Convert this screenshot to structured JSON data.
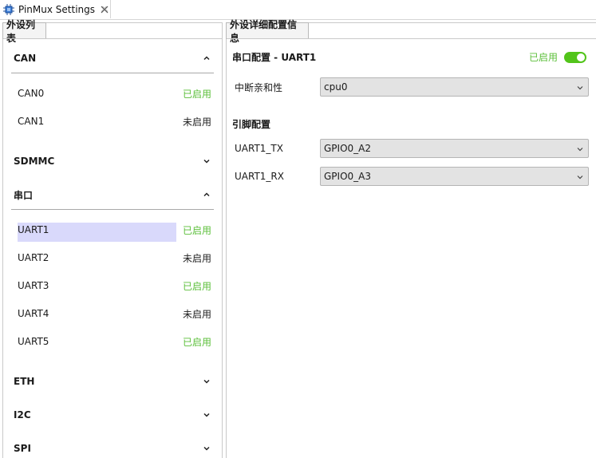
{
  "window": {
    "tab_title": "PinMux Settings"
  },
  "left_panel": {
    "tab_label": "外设列表",
    "groups": [
      {
        "title": "CAN",
        "expanded": true
      },
      {
        "title": "SDMMC",
        "expanded": false
      },
      {
        "title": "串口",
        "expanded": true
      },
      {
        "title": "ETH",
        "expanded": false
      },
      {
        "title": "I2C",
        "expanded": false
      },
      {
        "title": "SPI",
        "expanded": false
      }
    ],
    "can_items": [
      {
        "name": "CAN0",
        "status": "已启用"
      },
      {
        "name": "CAN1",
        "status": "未启用"
      }
    ],
    "uart_items": [
      {
        "name": "UART1",
        "status": "已启用",
        "selected": true
      },
      {
        "name": "UART2",
        "status": "未启用"
      },
      {
        "name": "UART3",
        "status": "已启用"
      },
      {
        "name": "UART4",
        "status": "未启用"
      },
      {
        "name": "UART5",
        "status": "已启用"
      }
    ]
  },
  "right_panel": {
    "tab_label": "外设详细配置信息",
    "serial_title": "串口配置 - UART1",
    "enabled_label": "已启用",
    "enabled": true,
    "affinity": {
      "label": "中断亲和性",
      "value": "cpu0"
    },
    "pin_title": "引脚配置",
    "pins": [
      {
        "label": "UART1_TX",
        "value": "GPIO0_A2"
      },
      {
        "label": "UART1_RX",
        "value": "GPIO0_A3"
      }
    ]
  },
  "colors": {
    "enabled_green": "#5bbf3a",
    "toggle_green": "#52c41a",
    "selection": "#d9d9fb"
  }
}
